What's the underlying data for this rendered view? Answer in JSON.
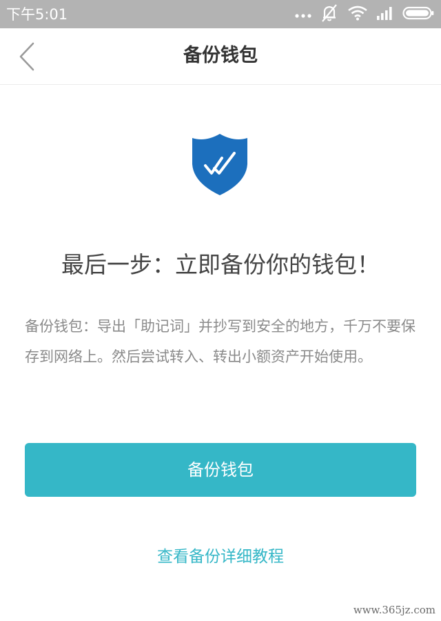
{
  "status_bar": {
    "time": "下午5:01",
    "icons": [
      "more-dots-icon",
      "silent-bell-icon",
      "wifi-icon",
      "signal-icon",
      "battery-icon"
    ]
  },
  "nav": {
    "back_icon": "chevron-left-icon",
    "title": "备份钱包"
  },
  "content": {
    "shield_icon": "shield-check-icon",
    "headline": "最后一步：立即备份你的钱包！",
    "description": "备份钱包：导出「助记词」并抄写到安全的地方，千万不要保存到网络上。然后尝试转入、转出小额资产开始使用。"
  },
  "actions": {
    "backup_button_label": "备份钱包",
    "tutorial_link_label": "查看备份详细教程"
  },
  "watermark": "www.365jz.com",
  "colors": {
    "accent": "#35b7c7",
    "shield": "#1c6fbd",
    "status_bar": "#b3b3b3"
  }
}
